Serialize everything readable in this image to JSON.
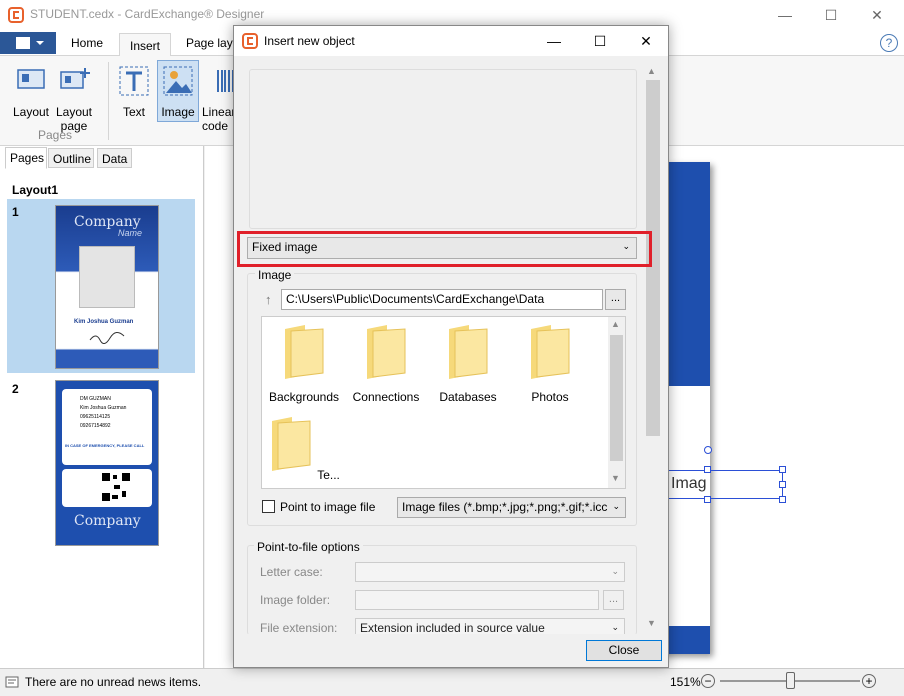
{
  "app": {
    "title": "STUDENT.cedx - CardExchange® Designer",
    "brand_color": "#e8612c"
  },
  "ribbon": {
    "tabs": [
      {
        "label": "Home"
      },
      {
        "label": "Insert"
      },
      {
        "label": "Page layo"
      }
    ],
    "buttons": {
      "layout": "Layout",
      "layout_page": "Layout page",
      "text": "Text",
      "image": "Image",
      "linear_code": "Linear code"
    },
    "groups": {
      "pages": "Pages"
    }
  },
  "left_pane": {
    "tabs": [
      {
        "label": "Pages"
      },
      {
        "label": "Outline"
      },
      {
        "label": "Data"
      }
    ],
    "layout_name": "Layout1",
    "page1_number": "1",
    "page2_number": "2",
    "card_front": {
      "company": "Company",
      "name_script": "Name",
      "person": "Kim Joshua Guzman"
    },
    "card_back": {
      "line1": "DM GUZMAN",
      "line2": "Kim Joshua Guzman",
      "line3": "09625114125",
      "line4": "09267154892",
      "emergency": "IN CASE OF EMERGENCY, PLEASE CALL",
      "company": "Company"
    }
  },
  "canvas": {
    "image_placeholder": "Imag"
  },
  "status": {
    "news": "There are no unread news items.",
    "zoom": "151%",
    "zoom_level": 0.5
  },
  "dialog": {
    "title": "Insert new object",
    "type_select": "Fixed image",
    "image_group": "Image",
    "path": "C:\\Users\\Public\\Documents\\CardExchange\\Data",
    "browse": "...",
    "folders": [
      {
        "name": "Backgrounds"
      },
      {
        "name": "Connections"
      },
      {
        "name": "Databases"
      },
      {
        "name": "Photos"
      },
      {
        "name": "Te..."
      }
    ],
    "point_to_file_label": "Point to image file",
    "filter_select": "Image files (*.bmp;*.jpg;*.png;*.gif;*.icc",
    "ptf_group": "Point-to-file options",
    "letter_case_label": "Letter case:",
    "image_folder_label": "Image folder:",
    "file_extension_label": "File extension:",
    "file_extension_value": "Extension included in source value",
    "close": "Close",
    "highlight_color": "#e0202a"
  }
}
